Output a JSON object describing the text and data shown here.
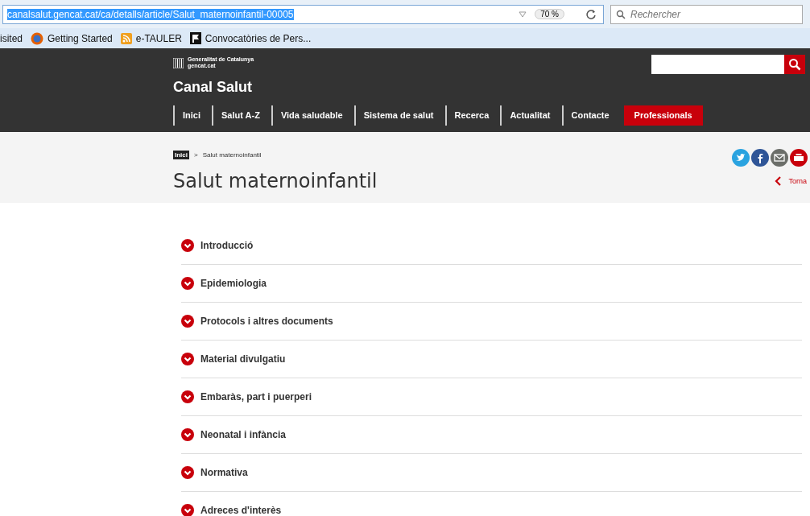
{
  "browser": {
    "url": "canalsalut.gencat.cat/ca/detalls/article/Salut_maternoinfantil-00005",
    "zoom": "70 %",
    "search_placeholder": "Rechercher",
    "bookmarks": [
      {
        "label": "isited",
        "kind": "plain"
      },
      {
        "label": "Getting Started",
        "kind": "browser"
      },
      {
        "label": "e-TAULER",
        "kind": "feed"
      },
      {
        "label": "Convocatòries de Pers...",
        "kind": "flag"
      }
    ]
  },
  "header": {
    "logo_line_1": "Generalitat de Catalunya",
    "logo_line_2": "gencat.cat",
    "site_title": "Canal Salut",
    "nav": [
      {
        "label": "Inici",
        "highlighted": false
      },
      {
        "label": "Salut A-Z",
        "highlighted": false
      },
      {
        "label": "Vida saludable",
        "highlighted": false
      },
      {
        "label": "Sistema de salut",
        "highlighted": false
      },
      {
        "label": "Recerca",
        "highlighted": false
      },
      {
        "label": "Actualitat",
        "highlighted": false
      },
      {
        "label": "Contacte",
        "highlighted": false
      },
      {
        "label": "Professionals",
        "highlighted": true
      }
    ]
  },
  "breadcrumb": [
    "Inici",
    ">",
    "Salut maternoinfantil"
  ],
  "page_title": "Salut maternoinfantil",
  "back_link": "Torna",
  "sections": [
    {
      "label": "Introducció",
      "expanded": false
    },
    {
      "label": "Epidemiologia",
      "expanded": false
    },
    {
      "label": "Protocols i altres documents",
      "expanded": false
    },
    {
      "label": "Material divulgatiu",
      "expanded": false
    },
    {
      "label": "Embaràs, part i puerperi",
      "expanded": false
    },
    {
      "label": "Neonatal i infància",
      "expanded": false
    },
    {
      "label": "Normativa",
      "expanded": false
    },
    {
      "label": "Adreces d'interès",
      "expanded": false
    }
  ]
}
